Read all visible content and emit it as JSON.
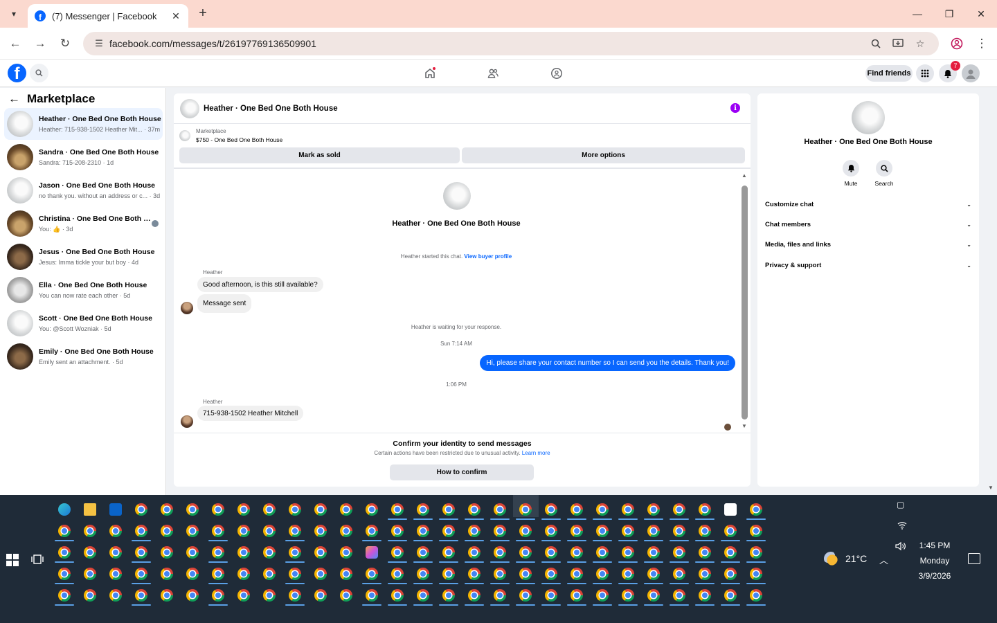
{
  "browser": {
    "tab_title": "(7) Messenger | Facebook",
    "url": "facebook.com/messages/t/26197769136509901"
  },
  "fb_header": {
    "find_friends": "Find friends",
    "notification_count": "7"
  },
  "sidebar": {
    "title": "Marketplace",
    "chats": [
      {
        "name": "Heather · One Bed One Both House",
        "preview": "Heather: 715-938-1502 Heather Mit... · 37m",
        "active": true,
        "thumb": "white"
      },
      {
        "name": "Sandra · One Bed One Both House",
        "preview": "Sandra: 715-208-2310 · 1d",
        "thumb": "wood"
      },
      {
        "name": "Jason · One Bed One Both House",
        "preview": "no thank you. without an address or c... · 3d",
        "thumb": "white"
      },
      {
        "name": "Christina · One Bed One Both H...",
        "preview": "You: 👍 · 3d",
        "thumb": "wood",
        "seen": true
      },
      {
        "name": "Jesus · One Bed One Both House",
        "preview": "Jesus: Imma tickle your but boy · 4d",
        "thumb": "dark"
      },
      {
        "name": "Ella · One Bed One Both House",
        "preview": "You can now rate each other · 5d",
        "thumb": "grey"
      },
      {
        "name": "Scott · One Bed One Both House",
        "preview": "You: @Scott Wozniak · 5d",
        "thumb": "white"
      },
      {
        "name": "Emily · One Bed One Both House",
        "preview": "Emily sent an attachment. · 5d",
        "thumb": "dark"
      }
    ]
  },
  "conversation": {
    "title": "Heather · One Bed One Both House",
    "listing_label": "Marketplace",
    "listing_title": "$750 - One Bed One Both House",
    "mark_sold": "Mark as sold",
    "more_options": "More options",
    "intro_name": "Heather · One Bed One Both House",
    "started_text": "Heather started this chat.",
    "view_buyer_profile": "View buyer profile",
    "sender_name_1": "Heather",
    "msg_1": "Good afternoon, is this still available?",
    "msg_2": "Message sent",
    "waiting_text": "Heather is waiting for your response.",
    "time_1": "Sun 7:14 AM",
    "msg_out": "Hi, please share your contact number so I can send you the details. Thank you!",
    "time_2": "1:06 PM",
    "sender_name_2": "Heather",
    "msg_3": "715-938-1502 Heather Mitchell",
    "confirm_title": "Confirm your identity to send messages",
    "confirm_sub": "Certain actions have been restricted due to unusual activity.",
    "learn_more": "Learn more",
    "how_to_confirm": "How to confirm"
  },
  "info_panel": {
    "name": "Heather · One Bed One Both House",
    "mute": "Mute",
    "search": "Search",
    "rows": [
      "Customize chat",
      "Chat members",
      "Media, files and links",
      "Privacy & support"
    ]
  },
  "taskbar": {
    "temperature": "21°C",
    "time": "1:45 PM",
    "day": "Monday",
    "date": "3/9/2026"
  },
  "colors": {
    "fb_blue": "#0866ff",
    "info_purple": "#9b00f5",
    "tab_bar": "#fbd9cf",
    "taskbar": "#1f2b38"
  }
}
